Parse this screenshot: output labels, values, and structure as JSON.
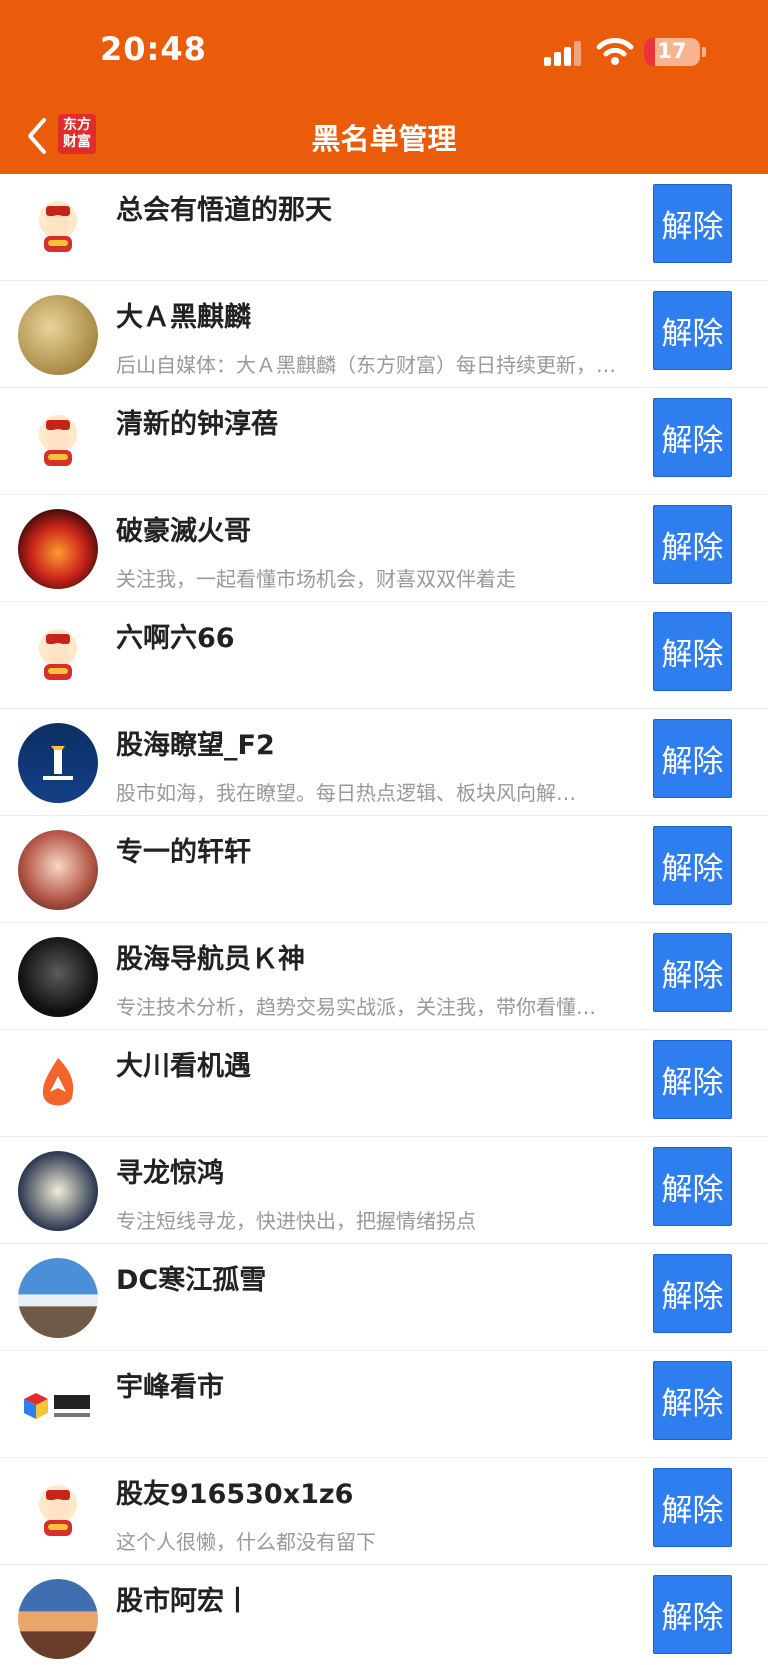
{
  "status_bar": {
    "time": "20:48",
    "battery": "17"
  },
  "nav": {
    "logo_line1": "东方",
    "logo_line2": "财富",
    "title": "黑名单管理"
  },
  "unblock_label": "解除",
  "rows": [
    {
      "name": "总会有悟道的那天",
      "desc": "",
      "avatar": "fortune-god"
    },
    {
      "name": "大Ａ黑麒麟",
      "desc": "后山自媒体：大Ａ黑麒麟（东方财富）每日持续更新，…",
      "avatar": "golden-qilin"
    },
    {
      "name": "清新的钟淳蓓",
      "desc": "",
      "avatar": "fortune-god"
    },
    {
      "name": "破豪滅火哥",
      "desc": "关注我，一起看懂市场机会，财喜双双伴着走",
      "avatar": "phoenix"
    },
    {
      "name": "六啊六66",
      "desc": "",
      "avatar": "fortune-god"
    },
    {
      "name": "股海瞭望_F2",
      "desc": "股市如海，我在瞭望。每日热点逻辑、板块风向解…",
      "avatar": "lighthouse"
    },
    {
      "name": "专一的轩轩",
      "desc": "",
      "avatar": "girl-portrait"
    },
    {
      "name": "股海导航员Ｋ神",
      "desc": "专注技术分析，趋势交易实战派，关注我，带你看懂…",
      "avatar": "tiger"
    },
    {
      "name": "大川看机遇",
      "desc": "",
      "avatar": "rocket-flame"
    },
    {
      "name": "寻龙惊鸿",
      "desc": "专注短线寻龙，快进快出，把握情绪拐点",
      "avatar": "dragon-calligraphy"
    },
    {
      "name": "DC寒江孤雪",
      "desc": "",
      "avatar": "snow-mountain"
    },
    {
      "name": "宇峰看市",
      "desc": "",
      "avatar": "yufeng-logo"
    },
    {
      "name": "股友916530x1z6",
      "desc": "这个人很懒，什么都没有留下",
      "avatar": "fortune-god"
    },
    {
      "name": "股市阿宏丨",
      "desc": "",
      "avatar": "sunset-mountain"
    }
  ]
}
